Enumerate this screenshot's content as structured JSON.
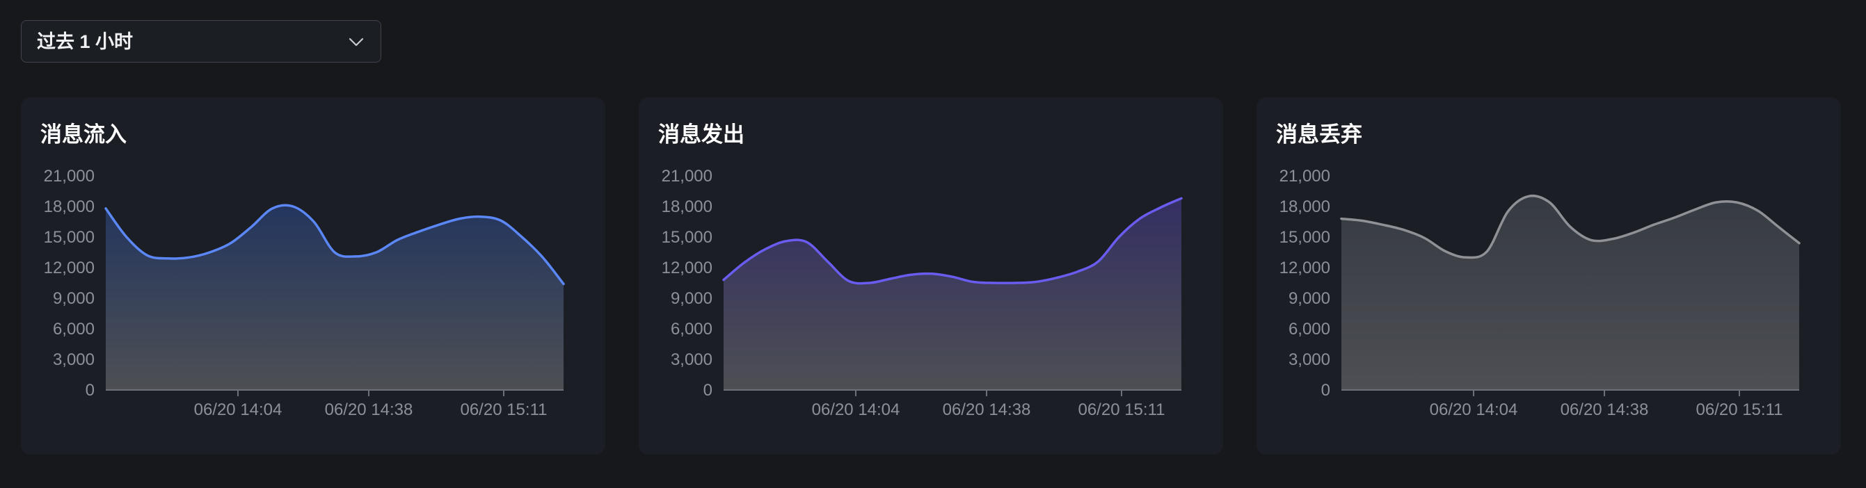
{
  "time_range": {
    "selected": "过去 1 小时",
    "icon": "chevron-down-icon"
  },
  "chart_data": [
    {
      "type": "area",
      "title": "消息流入",
      "color": "#5b87f7",
      "fill_top": "#24365e",
      "ylim": [
        0,
        21000
      ],
      "yticks": [
        "21,000",
        "18,000",
        "15,000",
        "12,000",
        "9,000",
        "6,000",
        "3,000",
        "0"
      ],
      "xticks": [
        "06/20 14:04",
        "06/20 14:38",
        "06/20 15:11"
      ],
      "grid": false,
      "values": [
        17800,
        15000,
        13200,
        12900,
        13000,
        13500,
        14400,
        16000,
        17800,
        18000,
        16500,
        13500,
        13100,
        13500,
        14700,
        15500,
        16200,
        16800,
        17000,
        16600,
        15000,
        13000,
        10400
      ]
    },
    {
      "type": "area",
      "title": "消息发出",
      "color": "#6b5cf0",
      "fill_top": "#342f62",
      "ylim": [
        0,
        21000
      ],
      "yticks": [
        "21,000",
        "18,000",
        "15,000",
        "12,000",
        "9,000",
        "6,000",
        "3,000",
        "0"
      ],
      "xticks": [
        "06/20 14:04",
        "06/20 14:38",
        "06/20 15:11"
      ],
      "grid": false,
      "values": [
        10800,
        12500,
        13800,
        14600,
        14500,
        12600,
        10700,
        10500,
        10900,
        11300,
        11400,
        11100,
        10600,
        10500,
        10500,
        10600,
        11000,
        11600,
        12600,
        15000,
        16800,
        17900,
        18800
      ]
    },
    {
      "type": "area",
      "title": "消息丢弃",
      "color": "#8f9197",
      "fill_top": "#363a42",
      "ylim": [
        0,
        21000
      ],
      "yticks": [
        "21,000",
        "18,000",
        "15,000",
        "12,000",
        "9,000",
        "6,000",
        "3,000",
        "0"
      ],
      "xticks": [
        "06/20 14:04",
        "06/20 14:38",
        "06/20 15:11"
      ],
      "grid": false,
      "values": [
        16800,
        16600,
        16200,
        15700,
        14900,
        13600,
        13000,
        13600,
        17500,
        19000,
        18400,
        16000,
        14700,
        14800,
        15400,
        16200,
        16900,
        17700,
        18400,
        18400,
        17600,
        16000,
        14400
      ]
    }
  ]
}
